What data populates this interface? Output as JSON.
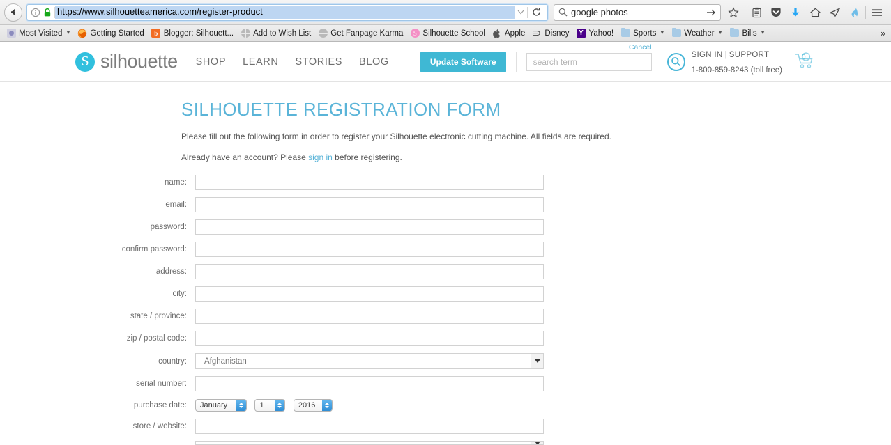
{
  "browser": {
    "url": "https://www.silhouetteamerica.com/register-product",
    "search_query": "google photos",
    "icons": {
      "back": "back-arrow-icon",
      "info": "info-icon",
      "lock": "padlock-icon",
      "reload": "reload-icon",
      "dropdown": "chevron-down-icon",
      "search": "search-icon",
      "go": "arrow-right-icon"
    },
    "toolbar_icons": [
      {
        "name": "bookmark-star-icon",
        "glyph": "star"
      },
      {
        "name": "reader-list-icon",
        "glyph": "clipboard"
      },
      {
        "name": "pocket-icon",
        "glyph": "shield"
      },
      {
        "name": "downloads-icon",
        "glyph": "down-arrow"
      },
      {
        "name": "home-icon",
        "glyph": "house"
      },
      {
        "name": "send-tab-icon",
        "glyph": "paper-plane"
      },
      {
        "name": "flame-icon",
        "glyph": "flame"
      },
      {
        "name": "menu-icon",
        "glyph": "hamburger"
      }
    ],
    "bookmarks": [
      {
        "label": "Most Visited",
        "icon": "most-visited-icon",
        "caret": true
      },
      {
        "label": "Getting Started",
        "icon": "firefox-icon",
        "caret": false
      },
      {
        "label": "Blogger: Silhouett...",
        "icon": "blogger-icon",
        "caret": false
      },
      {
        "label": "Add to Wish List",
        "icon": "globe-icon",
        "caret": false
      },
      {
        "label": "Get Fanpage Karma",
        "icon": "globe-icon",
        "caret": false
      },
      {
        "label": "Silhouette School",
        "icon": "silhouette-school-icon",
        "caret": false
      },
      {
        "label": "Apple",
        "icon": "apple-icon",
        "caret": false
      },
      {
        "label": "Disney",
        "icon": "disney-icon",
        "caret": false
      },
      {
        "label": "Yahoo!",
        "icon": "yahoo-icon",
        "caret": false
      },
      {
        "label": "Sports",
        "icon": "folder-icon",
        "caret": true
      },
      {
        "label": "Weather",
        "icon": "folder-icon",
        "caret": true
      },
      {
        "label": "Bills",
        "icon": "folder-icon",
        "caret": true
      }
    ],
    "overflow": "»"
  },
  "site": {
    "brand": "silhouette",
    "brand_mark_letter": "S",
    "nav": [
      "SHOP",
      "LEARN",
      "STORIES",
      "BLOG"
    ],
    "update_button": "Update Software",
    "cancel_link": "Cancel",
    "search_placeholder": "search term",
    "account_signin": "SIGN IN",
    "account_support": "SUPPORT",
    "account_phone": "1-800-859-8243 (toll free)",
    "cart_count": "0",
    "accent_color": "#3fb8d4",
    "logo_color": "#31c0de"
  },
  "page": {
    "title": "SILHOUETTE REGISTRATION FORM",
    "intro_1": "Please fill out the following form in order to register your Silhouette electronic cutting machine. All fields are required.",
    "intro_2_before": "Already have an account? Please ",
    "intro_2_link": "sign in",
    "intro_2_after": " before registering."
  },
  "form": {
    "fields": [
      {
        "label": "name:",
        "value": "",
        "type": "text"
      },
      {
        "label": "email:",
        "value": "",
        "type": "text"
      },
      {
        "label": "password:",
        "value": "",
        "type": "text"
      },
      {
        "label": "confirm password:",
        "value": "",
        "type": "text"
      },
      {
        "label": "address:",
        "value": "",
        "type": "text"
      },
      {
        "label": "city:",
        "value": "",
        "type": "text"
      },
      {
        "label": "state / province:",
        "value": "",
        "type": "text"
      },
      {
        "label": "zip / postal code:",
        "value": "",
        "type": "text"
      }
    ],
    "country": {
      "label": "country:",
      "value": "Afghanistan"
    },
    "serial": {
      "label": "serial number:",
      "value": ""
    },
    "purchase_date": {
      "label": "purchase date:",
      "month": "January",
      "day": "1",
      "year": "2016"
    },
    "store": {
      "label": "store / website:",
      "value": ""
    }
  }
}
